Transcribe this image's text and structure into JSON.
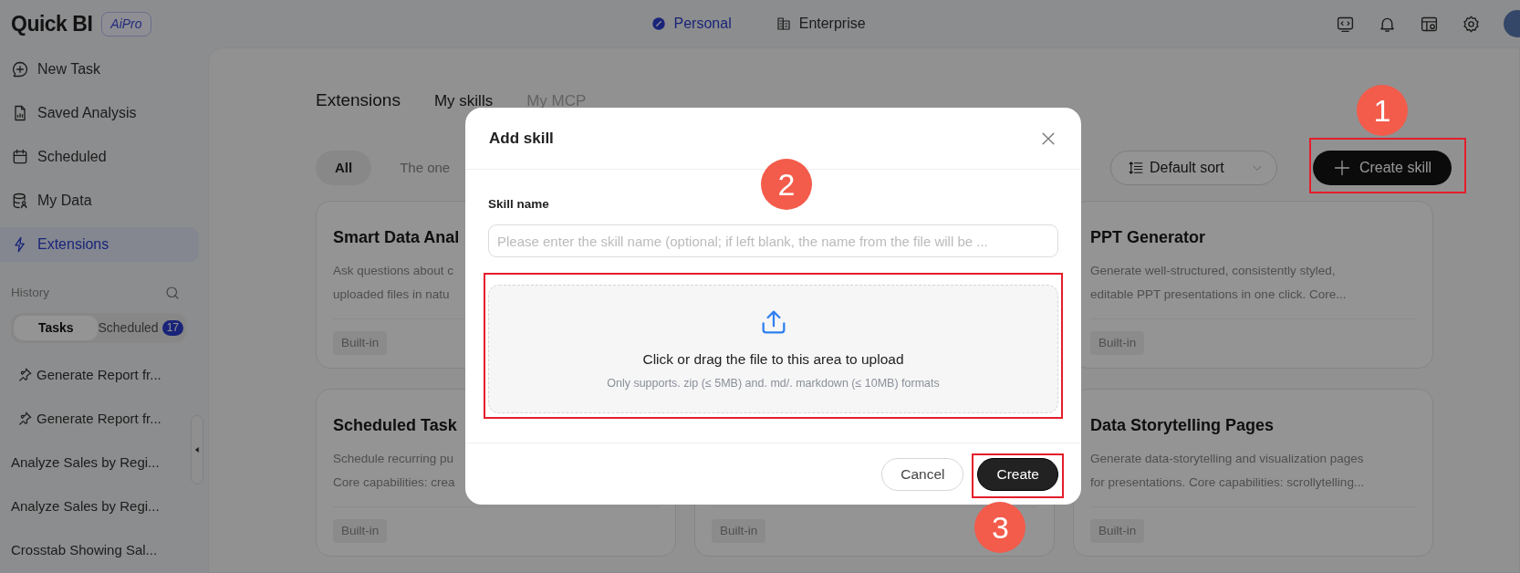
{
  "app": {
    "logo": "Quick BI",
    "badge": "AiPro"
  },
  "top_tabs": [
    {
      "label": "Personal",
      "selected": true
    },
    {
      "label": "Enterprise",
      "selected": false
    }
  ],
  "sidebar": {
    "items": [
      {
        "label": "New Task",
        "selected": false
      },
      {
        "label": "Saved Analysis",
        "selected": false
      },
      {
        "label": "Scheduled",
        "selected": false
      },
      {
        "label": "My Data",
        "selected": false
      },
      {
        "label": "Extensions",
        "selected": true
      }
    ],
    "history": {
      "title": "History",
      "tabs": [
        {
          "label": "Tasks",
          "selected": true
        },
        {
          "label": "Scheduled",
          "selected": false,
          "count": "17"
        }
      ],
      "items": [
        {
          "label": "Generate Report fr...",
          "pinned": true
        },
        {
          "label": "Generate Report fr...",
          "pinned": true
        },
        {
          "label": "Analyze Sales by Regi...",
          "pinned": false
        },
        {
          "label": "Analyze Sales by Regi...",
          "pinned": false
        },
        {
          "label": "Crosstab Showing Sal...",
          "pinned": false
        }
      ]
    }
  },
  "page": {
    "title": "Extensions",
    "tabs": [
      {
        "label": "My skills",
        "selected": true
      },
      {
        "label": "My MCP",
        "selected": false
      }
    ],
    "filters": [
      {
        "label": "All",
        "selected": true
      },
      {
        "label": "The one",
        "selected": false
      }
    ],
    "sort": {
      "value": "Default sort"
    },
    "create_button": "Create skill",
    "cards": [
      {
        "title": "Smart Data Anal",
        "description": [
          "Ask questions about c",
          "uploaded files in natu"
        ],
        "tag": "Built-in"
      },
      {
        "title": "PPT Generator",
        "description": [
          "Generate well-structured, consistently styled,",
          "editable PPT presentations in one click. Core..."
        ],
        "tag": "Built-in"
      },
      {
        "title": "Scheduled Task",
        "description": [
          "Schedule recurring pu",
          "Core capabilities: crea"
        ],
        "tag": "Built-in"
      },
      {
        "tag": "Built-in"
      },
      {
        "title": "Data Storytelling Pages",
        "description": [
          "Generate data-storytelling and visualization pages",
          "for presentations. Core capabilities: scrollytelling..."
        ],
        "tag": "Built-in"
      }
    ]
  },
  "dialog": {
    "title": "Add skill",
    "field_label": "Skill name",
    "placeholder": "Please enter the skill name (optional; if left blank, the name from the file will be ...",
    "upload_text": "Click or drag the file to this area to upload",
    "upload_hint": "Only supports. zip (≤ 5MB) and. md/. markdown (≤ 10MB) formats",
    "buttons": [
      {
        "label": "Cancel",
        "kind": "secondary"
      },
      {
        "label": "Create",
        "kind": "primary"
      }
    ]
  },
  "annotations": [
    {
      "label": "1"
    },
    {
      "label": "2"
    },
    {
      "label": "3"
    }
  ]
}
